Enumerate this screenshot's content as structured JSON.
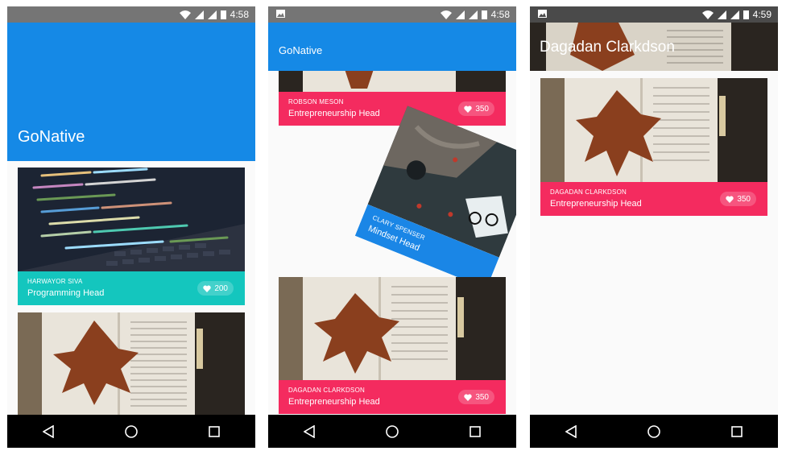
{
  "status": {
    "time1": "4:58",
    "time2": "4:58",
    "time3": "4:59"
  },
  "screen1": {
    "title": "GoNative",
    "cards": [
      {
        "name": "HARWAYOR SIVA",
        "role": "Programming Head",
        "likes": "200"
      }
    ]
  },
  "screen2": {
    "title": "GoNative",
    "cards": [
      {
        "name": "ROBSON MESON",
        "role": "Entrepreneurship Head",
        "likes": "350"
      },
      {
        "name": "CLARY SPENSER",
        "role": "Mindset Head"
      },
      {
        "name": "DAGADAN CLARKDSON",
        "role": "Entrepreneurship Head",
        "likes": "350"
      }
    ]
  },
  "screen3": {
    "title": "Dagadan Clarkdson",
    "card": {
      "name": "DAGADAN CLARKDSON",
      "role": "Entrepreneurship Head",
      "likes": "350"
    }
  },
  "colors": {
    "primary": "#1589e6",
    "pink": "#f42b5f",
    "teal": "#14c6be"
  },
  "icons": [
    "wifi-icon",
    "signal-icon",
    "battery-icon",
    "image-notification-icon",
    "heart-icon",
    "back-icon",
    "home-icon",
    "recents-icon"
  ]
}
